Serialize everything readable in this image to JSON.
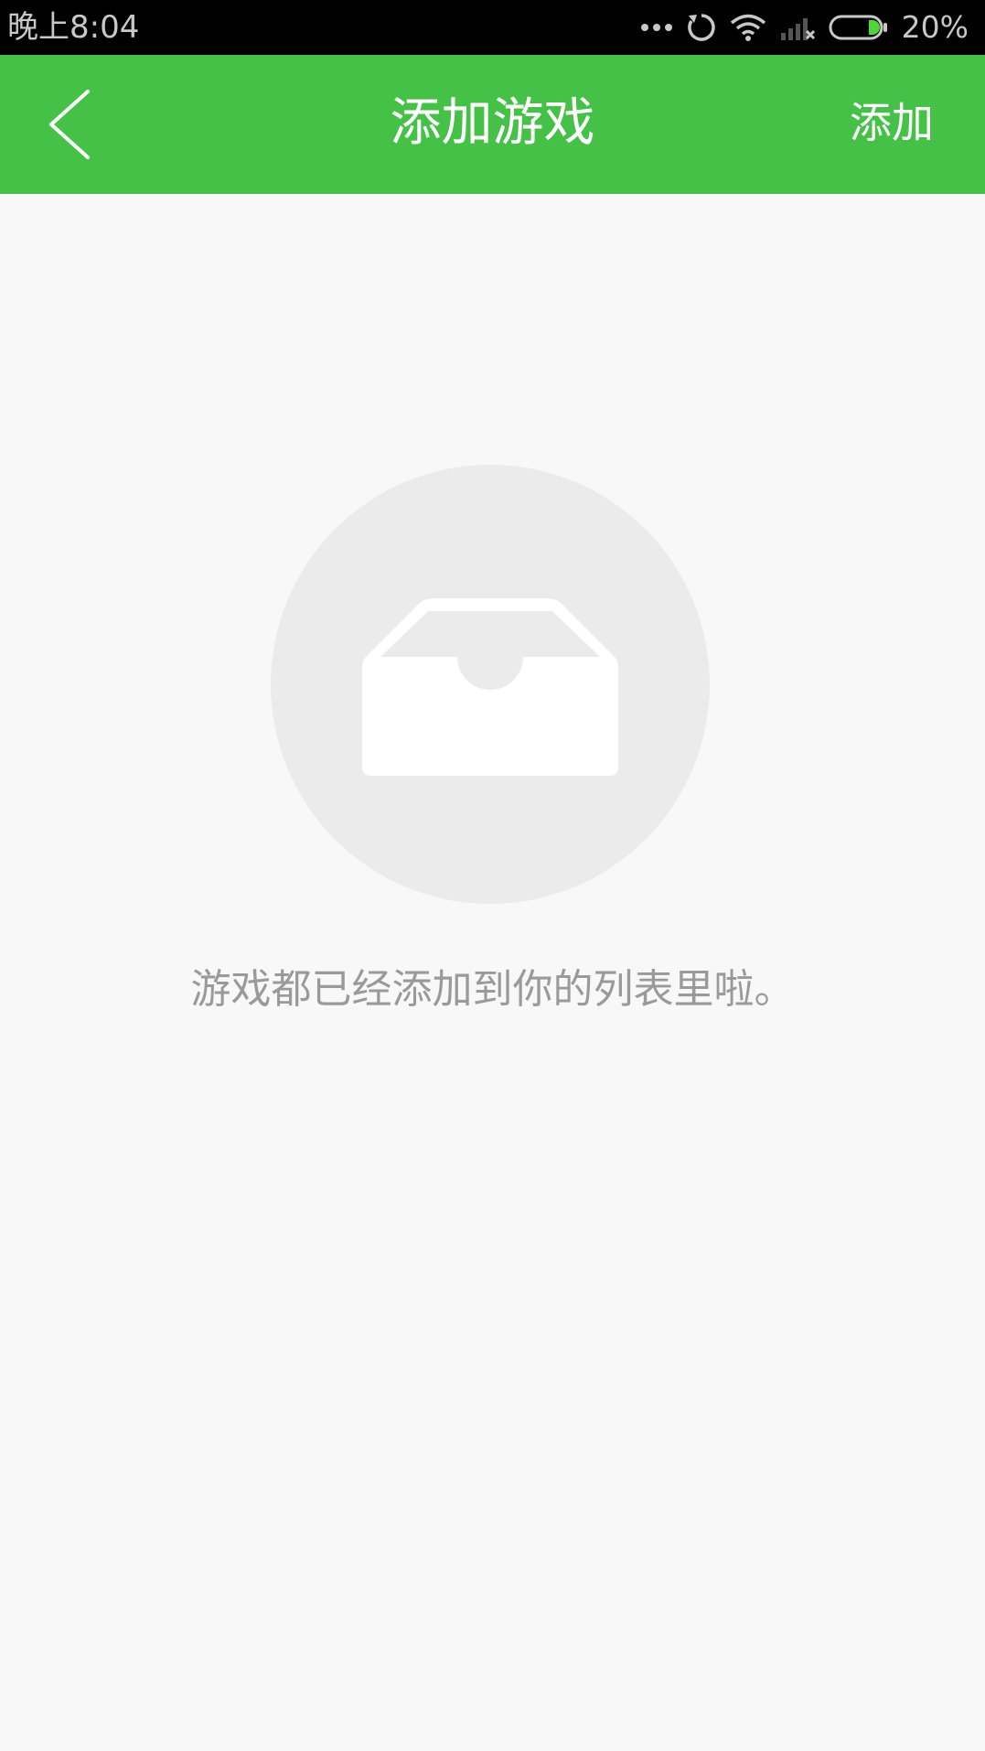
{
  "status_bar": {
    "time": "晚上8:04",
    "battery_percent": "20%",
    "icons": [
      "more-dots-icon",
      "sync-icon",
      "wifi-icon",
      "signal-no-service-icon",
      "battery-icon"
    ]
  },
  "header": {
    "title": "添加游戏",
    "action_label": "添加",
    "back_icon": "chevron-left-icon",
    "background_color": "#45c148"
  },
  "empty_state": {
    "icon": "empty-inbox-icon",
    "message": "游戏都已经添加到你的列表里啦。"
  },
  "colors": {
    "accent": "#45c148",
    "page_background": "#f8f8f8",
    "empty_circle": "#ebebeb",
    "message_text": "#9a9a9a"
  }
}
